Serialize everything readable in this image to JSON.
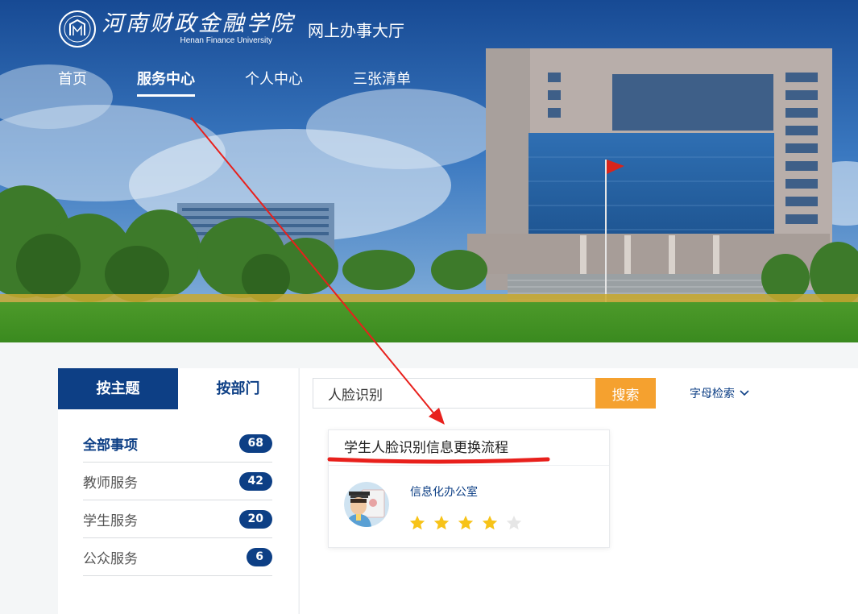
{
  "header": {
    "school_name_cn": "河南财政金融学院",
    "school_name_en": "Henan Finance University",
    "portal_name": "网上办事大厅"
  },
  "nav": {
    "items": [
      {
        "label": "首页",
        "active": false
      },
      {
        "label": "服务中心",
        "active": true
      },
      {
        "label": "个人中心",
        "active": false
      },
      {
        "label": "三张清单",
        "active": false
      }
    ]
  },
  "sidebar": {
    "tabs": [
      {
        "label": "按主题",
        "active": true
      },
      {
        "label": "按部门",
        "active": false
      }
    ],
    "categories": [
      {
        "label": "全部事项",
        "count": "68",
        "active": true
      },
      {
        "label": "教师服务",
        "count": "42",
        "active": false
      },
      {
        "label": "学生服务",
        "count": "20",
        "active": false
      },
      {
        "label": "公众服务",
        "count": "6",
        "active": false
      }
    ]
  },
  "search": {
    "value": "人脸识别",
    "button_label": "搜索",
    "alpha_label": "字母检索"
  },
  "result_card": {
    "title": "学生人脸识别信息更换流程",
    "department": "信息化办公室",
    "rating": 4,
    "rating_max": 5
  },
  "colors": {
    "brand": "#0d3f85",
    "accent": "#f5a12f",
    "star_on": "#f7c318",
    "star_off": "#e6e6e6",
    "annotation": "#e8201c"
  }
}
